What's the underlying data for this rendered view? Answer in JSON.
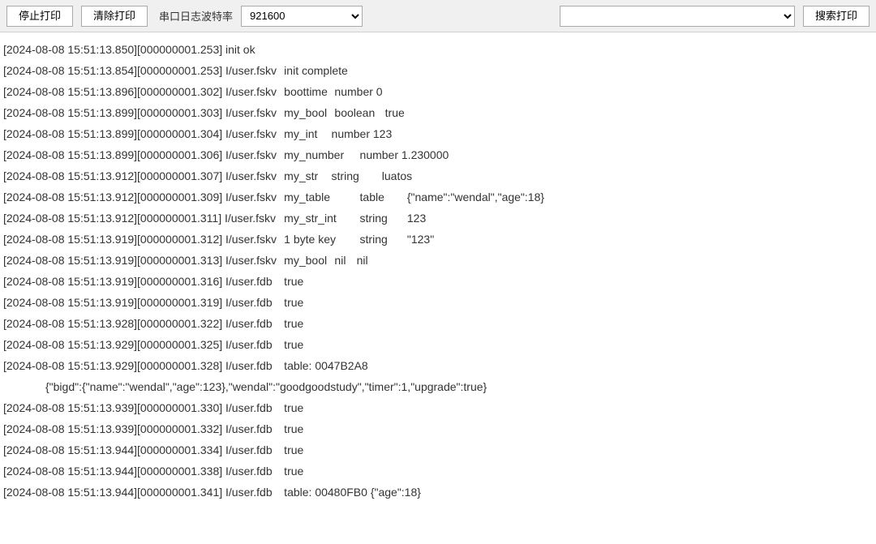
{
  "toolbar": {
    "stop_print_label": "停止打印",
    "clear_print_label": "清除打印",
    "baud_label": "串口日志波特率",
    "baud_value": "921600",
    "search_value": "",
    "search_button_label": "搜索打印"
  },
  "log": {
    "lines": [
      {
        "text": "[2024-08-08 15:51:13.850][000000001.253] init ok",
        "indent": false
      },
      {
        "text": "[2024-08-08 15:51:13.854][000000001.253] I/user.fskv\t init complete",
        "indent": false
      },
      {
        "text": "[2024-08-08 15:51:13.896][000000001.302] I/user.fskv\t boottime\t number 0",
        "indent": false
      },
      {
        "text": "[2024-08-08 15:51:13.899][000000001.303] I/user.fskv\t my_bool\t boolean\t true",
        "indent": false
      },
      {
        "text": "[2024-08-08 15:51:13.899][000000001.304] I/user.fskv\t my_int\tnumber 123",
        "indent": false
      },
      {
        "text": "[2024-08-08 15:51:13.899][000000001.306] I/user.fskv\t my_number\t number 1.230000",
        "indent": false
      },
      {
        "text": "[2024-08-08 15:51:13.912][000000001.307] I/user.fskv\t my_str\tstring\tluatos",
        "indent": false
      },
      {
        "text": "[2024-08-08 15:51:13.912][000000001.309] I/user.fskv\t my_table\t table\t{\"name\":\"wendal\",\"age\":18}",
        "indent": false
      },
      {
        "text": "[2024-08-08 15:51:13.912][000000001.311] I/user.fskv\t my_str_int\t string\t123",
        "indent": false
      },
      {
        "text": "[2024-08-08 15:51:13.919][000000001.312] I/user.fskv\t 1 byte key\t string\t\"123\"",
        "indent": false
      },
      {
        "text": "[2024-08-08 15:51:13.919][000000001.313] I/user.fskv\t my_bool\t nil\tnil",
        "indent": false
      },
      {
        "text": "[2024-08-08 15:51:13.919][000000001.316] I/user.fdb\t true",
        "indent": false
      },
      {
        "text": "[2024-08-08 15:51:13.919][000000001.319] I/user.fdb\t true",
        "indent": false
      },
      {
        "text": "[2024-08-08 15:51:13.928][000000001.322] I/user.fdb\t true",
        "indent": false
      },
      {
        "text": "[2024-08-08 15:51:13.929][000000001.325] I/user.fdb\t true",
        "indent": false
      },
      {
        "text": "[2024-08-08 15:51:13.929][000000001.328] I/user.fdb\t table: 0047B2A8",
        "indent": false
      },
      {
        "text": "{\"bigd\":{\"name\":\"wendal\",\"age\":123},\"wendal\":\"goodgoodstudy\",\"timer\":1,\"upgrade\":true}",
        "indent": true
      },
      {
        "text": "[2024-08-08 15:51:13.939][000000001.330] I/user.fdb\t true",
        "indent": false
      },
      {
        "text": "[2024-08-08 15:51:13.939][000000001.332] I/user.fdb\t true",
        "indent": false
      },
      {
        "text": "[2024-08-08 15:51:13.944][000000001.334] I/user.fdb\t true",
        "indent": false
      },
      {
        "text": "[2024-08-08 15:51:13.944][000000001.338] I/user.fdb\t true",
        "indent": false
      },
      {
        "text": "[2024-08-08 15:51:13.944][000000001.341] I/user.fdb\t table: 00480FB0 {\"age\":18}",
        "indent": false
      }
    ]
  }
}
